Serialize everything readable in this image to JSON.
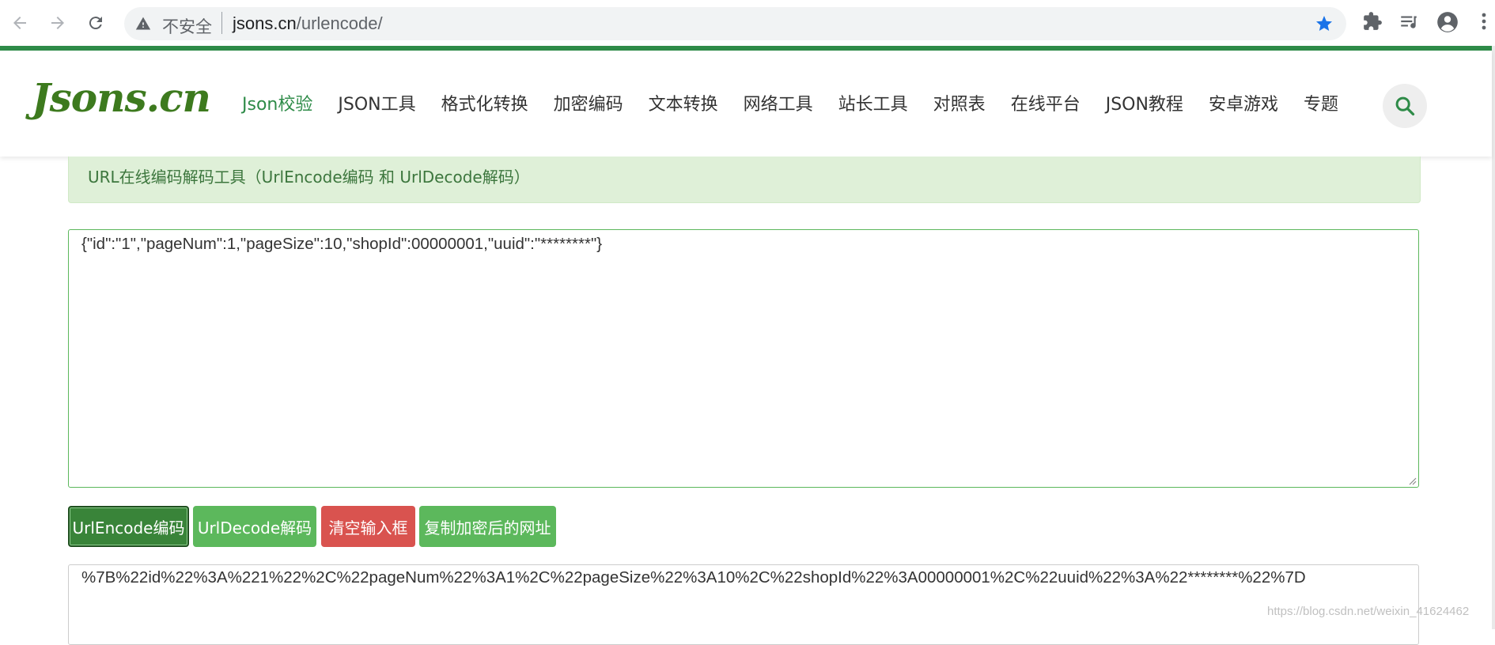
{
  "browser": {
    "insecure_label": "不安全",
    "url_host": "jsons.cn",
    "url_path": "/urlencode/"
  },
  "site": {
    "logo": "Jsons.cn",
    "menu": [
      {
        "label": "Json校验",
        "active": true
      },
      {
        "label": "JSON工具"
      },
      {
        "label": "格式化转换"
      },
      {
        "label": "加密编码"
      },
      {
        "label": "文本转换"
      },
      {
        "label": "网络工具"
      },
      {
        "label": "站长工具"
      },
      {
        "label": "对照表"
      },
      {
        "label": "在线平台"
      },
      {
        "label": "JSON教程"
      },
      {
        "label": "安卓游戏"
      },
      {
        "label": "专题"
      }
    ]
  },
  "banner": {
    "title": "URL在线编码解码工具（UrlEncode编码 和 UrlDecode解码）"
  },
  "input": {
    "value": "{\"id\":\"1\",\"pageNum\":1,\"pageSize\":10,\"shopId\":00000001,\"uuid\":\"********\"}"
  },
  "buttons": {
    "encode": "UrlEncode编码",
    "decode": "UrlDecode解码",
    "clear": "清空输入框",
    "copy": "复制加密后的网址"
  },
  "output": {
    "value": "%7B%22id%22%3A%221%22%2C%22pageNum%22%3A1%2C%22pageSize%22%3A10%2C%22shopId%22%3A00000001%2C%22uuid%22%3A%22********%22%7D"
  },
  "watermark": "https://blog.csdn.net/weixin_41624462",
  "colors": {
    "brand_green": "#2e8b48",
    "button_green": "#5cb85c",
    "button_red": "#d9534f",
    "banner_bg": "#dff0d8"
  }
}
